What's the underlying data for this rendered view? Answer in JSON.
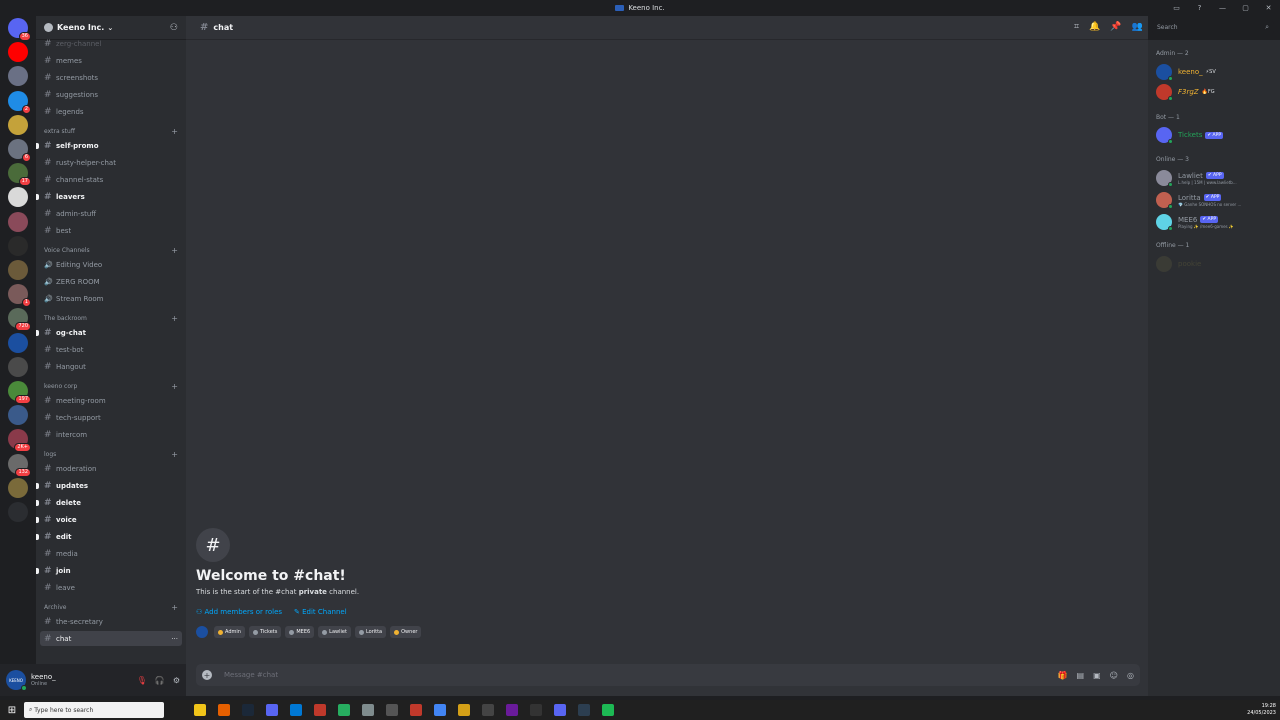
{
  "window": {
    "title": "Keeno Inc.",
    "controls": [
      "▭",
      "?",
      "—",
      "▢",
      "✕"
    ]
  },
  "servers": [
    {
      "icon": "discord-home-icon",
      "color": "#5865f2",
      "badge": "36"
    },
    {
      "icon": "youtube-icon",
      "color": "#ff0000",
      "badge": ""
    },
    {
      "icon": "server-icon",
      "color": "#6a7085",
      "badge": ""
    },
    {
      "icon": "server-icon",
      "color": "#1f8ce6",
      "badge": "2"
    },
    {
      "icon": "server-icon",
      "color": "#c4a23a",
      "badge": ""
    },
    {
      "icon": "server-icon",
      "color": "#6b7280",
      "badge": "6"
    },
    {
      "icon": "server-icon",
      "color": "#4a6b3a",
      "badge": "17"
    },
    {
      "icon": "server-icon",
      "color": "#d9d9d9",
      "badge": ""
    },
    {
      "icon": "server-icon",
      "color": "#8a4a5a",
      "badge": ""
    },
    {
      "icon": "server-icon",
      "color": "#2a2a2a",
      "badge": ""
    },
    {
      "icon": "server-icon",
      "color": "#6b5a3a",
      "badge": ""
    },
    {
      "icon": "server-icon",
      "color": "#7a5a5a",
      "badge": "1"
    },
    {
      "icon": "server-icon",
      "color": "#5a6a5a",
      "badge": "720"
    },
    {
      "icon": "server-icon",
      "color": "#1b4fa0",
      "badge": ""
    },
    {
      "icon": "server-icon",
      "color": "#4a4a4a",
      "badge": ""
    },
    {
      "icon": "server-icon",
      "color": "#4a8a3a",
      "badge": "197"
    },
    {
      "icon": "server-icon",
      "color": "#3a5a8a",
      "badge": ""
    },
    {
      "icon": "server-icon",
      "color": "#8a3a4a",
      "badge": "2K+"
    },
    {
      "icon": "server-icon",
      "color": "#6a6a6a",
      "badge": "132"
    },
    {
      "icon": "server-icon",
      "color": "#7a6a3a",
      "badge": ""
    },
    {
      "icon": "server-icon",
      "color": "#2b2d31",
      "badge": ""
    }
  ],
  "guild": {
    "name": "Keeno Inc."
  },
  "channel_list": [
    {
      "type": "channel",
      "name": "zerg-channel",
      "state": "muted"
    },
    {
      "type": "channel",
      "name": "memes",
      "state": ""
    },
    {
      "type": "channel",
      "name": "screenshots",
      "state": ""
    },
    {
      "type": "channel",
      "name": "suggestions",
      "state": ""
    },
    {
      "type": "channel",
      "name": "legends",
      "state": ""
    },
    {
      "type": "category",
      "name": "extra stuff"
    },
    {
      "type": "channel",
      "name": "self-promo",
      "state": "unread"
    },
    {
      "type": "channel",
      "name": "rusty-helper-chat",
      "state": ""
    },
    {
      "type": "channel",
      "name": "channel-stats",
      "state": ""
    },
    {
      "type": "channel",
      "name": "leavers",
      "state": "unread"
    },
    {
      "type": "channel",
      "name": "admin-stuff",
      "state": ""
    },
    {
      "type": "channel",
      "name": "best",
      "state": ""
    },
    {
      "type": "category",
      "name": "Voice Channels"
    },
    {
      "type": "voice",
      "name": "Editing Video",
      "state": ""
    },
    {
      "type": "voice",
      "name": "ZERG ROOM",
      "state": ""
    },
    {
      "type": "voice",
      "name": "Stream Room",
      "state": ""
    },
    {
      "type": "category",
      "name": "The backroom"
    },
    {
      "type": "channel",
      "name": "og-chat",
      "state": "unread"
    },
    {
      "type": "channel",
      "name": "test-bot",
      "state": ""
    },
    {
      "type": "channel",
      "name": "Hangout",
      "state": ""
    },
    {
      "type": "category",
      "name": "keeno corp"
    },
    {
      "type": "channel",
      "name": "meeting-room",
      "state": ""
    },
    {
      "type": "channel",
      "name": "tech-support",
      "state": ""
    },
    {
      "type": "channel",
      "name": "intercom",
      "state": ""
    },
    {
      "type": "category",
      "name": "logs"
    },
    {
      "type": "channel",
      "name": "moderation",
      "state": ""
    },
    {
      "type": "channel",
      "name": "updates",
      "state": "unread"
    },
    {
      "type": "channel",
      "name": "delete",
      "state": "unread"
    },
    {
      "type": "channel",
      "name": "voice",
      "state": "unread"
    },
    {
      "type": "channel",
      "name": "edit",
      "state": "unread"
    },
    {
      "type": "channel",
      "name": "media",
      "state": ""
    },
    {
      "type": "channel",
      "name": "join",
      "state": "unread"
    },
    {
      "type": "channel",
      "name": "leave",
      "state": ""
    },
    {
      "type": "category",
      "name": "Archive"
    },
    {
      "type": "channel",
      "name": "the-secretary",
      "state": ""
    },
    {
      "type": "channel",
      "name": "chat",
      "state": "active"
    }
  ],
  "user": {
    "avatar_text": "KEENO",
    "name": "keeno_",
    "status": "Online"
  },
  "header": {
    "channel": "chat"
  },
  "search": {
    "placeholder": "Search"
  },
  "welcome": {
    "title": "Welcome to #chat!",
    "sub_prefix": "This is the start of the #chat ",
    "sub_bold": "private",
    "sub_suffix": " channel.",
    "add_members": "Add members or roles",
    "edit_channel": "Edit Channel"
  },
  "roles": [
    {
      "name": "Admin",
      "color": "#f0b232"
    },
    {
      "name": "Tickets",
      "color": "#949ba4"
    },
    {
      "name": "MEE6",
      "color": "#949ba4"
    },
    {
      "name": "Lawliet",
      "color": "#949ba4"
    },
    {
      "name": "Loritta",
      "color": "#949ba4"
    },
    {
      "name": "Owner",
      "color": "#f0b232"
    }
  ],
  "composer": {
    "placeholder": "Message #chat"
  },
  "members": {
    "admin_header": "Admin — 2",
    "bot_header": "Bot — 1",
    "online_header": "Online — 3",
    "offline_header": "Offline — 1",
    "list": [
      {
        "name": "keeno_",
        "tag": "⚡SV",
        "status": "",
        "color": "#f0b232",
        "app": false,
        "avatar": "#1b4fa0",
        "group": "admin"
      },
      {
        "name": "F3rgZ",
        "tag": "🔥FG",
        "status": "",
        "color": "#f0b232",
        "app": false,
        "avatar": "#c0392b",
        "group": "admin"
      },
      {
        "name": "Tickets",
        "tag": "",
        "status": "",
        "color": "#23a55a",
        "app": true,
        "avatar": "#5865f2",
        "group": "bot"
      },
      {
        "name": "Lawliet",
        "tag": "",
        "status": "L.help | 15M | www.lawlietb...",
        "color": "#949ba4",
        "app": true,
        "avatar": "#8a8a9a",
        "group": "online"
      },
      {
        "name": "Loritta",
        "tag": "",
        "status": "💎 Ganhe SONHOS no server ...",
        "color": "#949ba4",
        "app": true,
        "avatar": "#c06050",
        "group": "online"
      },
      {
        "name": "MEE6",
        "tag": "",
        "status": "Playing ✨ /mee6-games ✨",
        "color": "#949ba4",
        "app": true,
        "avatar": "#5fd3e6",
        "group": "online"
      },
      {
        "name": "pookie",
        "tag": "",
        "status": "",
        "color": "#5c5a3a",
        "app": false,
        "avatar": "#4a4a3a",
        "group": "offline"
      }
    ],
    "app_label": "✔ APP"
  },
  "taskbar": {
    "search_placeholder": "Type here to search",
    "time": "19:28",
    "date": "24/05/2023"
  }
}
